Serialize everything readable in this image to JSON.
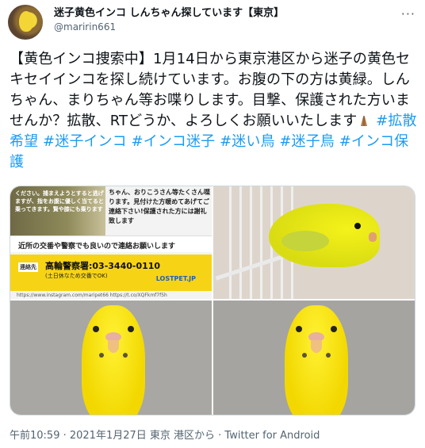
{
  "tweet": {
    "display_name": "迷子黄色インコ しんちゃん探しています【東京】",
    "handle": "@maririn661",
    "more_icon": "more-icon",
    "text_plain": "【黄色インコ捜索中】1月14日から東京港区から迷子の黄色セキセイインコを探し続けています。お腹の下の方は黄緑。しんちゃん、まりちゃん等お喋りします。目撃、保護された方いませんか？拡散、RTどうか、よろしくお願いいたします",
    "hashtags": [
      "#拡散希望",
      "#迷子インコ",
      "#インコ迷子",
      "#迷い鳥",
      "#迷子鳥",
      "#インコ保護"
    ],
    "emoji": "folded-hands-emoji",
    "timestamp": "午前10:59 · 2021年1月27日 東京 港区から · Twitter for Android"
  },
  "media": {
    "poster": {
      "top_red_text": "ください。捕まえようとすると逃げますが、指をお腹に優しく当てると乗ってきます。賢や膝にも乗ります",
      "right_text": "ちゃん、おりこうさん等たくさん喋ります。見付けた方暖めてあげてご連絡下さい!保護された方には謝礼致します",
      "middle_line": "近所の交番や警察でも良いので連絡お願いします",
      "contact_tag": "連絡先",
      "phone": "高輪警察署:03-3440-0110",
      "phone_sub": "(土日休なため交番でOK)",
      "logo": "LOSTPET.JP",
      "footer": "https://www.instagram.com/maripet66   https://t.co/XQFkmf7f5h"
    }
  }
}
